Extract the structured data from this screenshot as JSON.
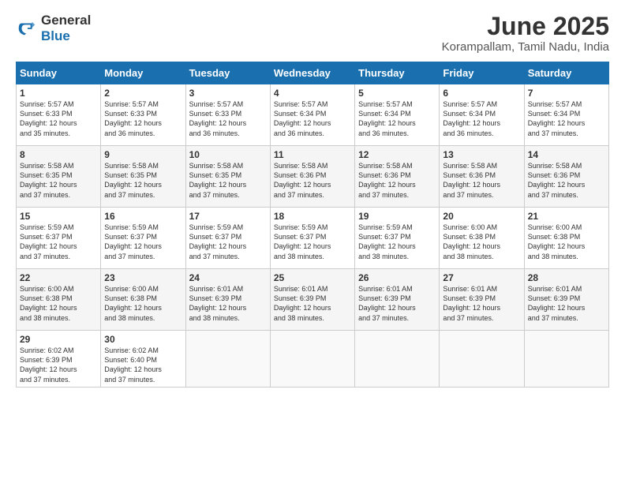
{
  "header": {
    "logo_general": "General",
    "logo_blue": "Blue",
    "title": "June 2025",
    "subtitle": "Korampallam, Tamil Nadu, India"
  },
  "weekdays": [
    "Sunday",
    "Monday",
    "Tuesday",
    "Wednesday",
    "Thursday",
    "Friday",
    "Saturday"
  ],
  "weeks": [
    [
      {
        "day": "1",
        "info": "Sunrise: 5:57 AM\nSunset: 6:33 PM\nDaylight: 12 hours\nand 35 minutes."
      },
      {
        "day": "2",
        "info": "Sunrise: 5:57 AM\nSunset: 6:33 PM\nDaylight: 12 hours\nand 36 minutes."
      },
      {
        "day": "3",
        "info": "Sunrise: 5:57 AM\nSunset: 6:33 PM\nDaylight: 12 hours\nand 36 minutes."
      },
      {
        "day": "4",
        "info": "Sunrise: 5:57 AM\nSunset: 6:34 PM\nDaylight: 12 hours\nand 36 minutes."
      },
      {
        "day": "5",
        "info": "Sunrise: 5:57 AM\nSunset: 6:34 PM\nDaylight: 12 hours\nand 36 minutes."
      },
      {
        "day": "6",
        "info": "Sunrise: 5:57 AM\nSunset: 6:34 PM\nDaylight: 12 hours\nand 36 minutes."
      },
      {
        "day": "7",
        "info": "Sunrise: 5:57 AM\nSunset: 6:34 PM\nDaylight: 12 hours\nand 37 minutes."
      }
    ],
    [
      {
        "day": "8",
        "info": "Sunrise: 5:58 AM\nSunset: 6:35 PM\nDaylight: 12 hours\nand 37 minutes."
      },
      {
        "day": "9",
        "info": "Sunrise: 5:58 AM\nSunset: 6:35 PM\nDaylight: 12 hours\nand 37 minutes."
      },
      {
        "day": "10",
        "info": "Sunrise: 5:58 AM\nSunset: 6:35 PM\nDaylight: 12 hours\nand 37 minutes."
      },
      {
        "day": "11",
        "info": "Sunrise: 5:58 AM\nSunset: 6:36 PM\nDaylight: 12 hours\nand 37 minutes."
      },
      {
        "day": "12",
        "info": "Sunrise: 5:58 AM\nSunset: 6:36 PM\nDaylight: 12 hours\nand 37 minutes."
      },
      {
        "day": "13",
        "info": "Sunrise: 5:58 AM\nSunset: 6:36 PM\nDaylight: 12 hours\nand 37 minutes."
      },
      {
        "day": "14",
        "info": "Sunrise: 5:58 AM\nSunset: 6:36 PM\nDaylight: 12 hours\nand 37 minutes."
      }
    ],
    [
      {
        "day": "15",
        "info": "Sunrise: 5:59 AM\nSunset: 6:37 PM\nDaylight: 12 hours\nand 37 minutes."
      },
      {
        "day": "16",
        "info": "Sunrise: 5:59 AM\nSunset: 6:37 PM\nDaylight: 12 hours\nand 37 minutes."
      },
      {
        "day": "17",
        "info": "Sunrise: 5:59 AM\nSunset: 6:37 PM\nDaylight: 12 hours\nand 37 minutes."
      },
      {
        "day": "18",
        "info": "Sunrise: 5:59 AM\nSunset: 6:37 PM\nDaylight: 12 hours\nand 38 minutes."
      },
      {
        "day": "19",
        "info": "Sunrise: 5:59 AM\nSunset: 6:37 PM\nDaylight: 12 hours\nand 38 minutes."
      },
      {
        "day": "20",
        "info": "Sunrise: 6:00 AM\nSunset: 6:38 PM\nDaylight: 12 hours\nand 38 minutes."
      },
      {
        "day": "21",
        "info": "Sunrise: 6:00 AM\nSunset: 6:38 PM\nDaylight: 12 hours\nand 38 minutes."
      }
    ],
    [
      {
        "day": "22",
        "info": "Sunrise: 6:00 AM\nSunset: 6:38 PM\nDaylight: 12 hours\nand 38 minutes."
      },
      {
        "day": "23",
        "info": "Sunrise: 6:00 AM\nSunset: 6:38 PM\nDaylight: 12 hours\nand 38 minutes."
      },
      {
        "day": "24",
        "info": "Sunrise: 6:01 AM\nSunset: 6:39 PM\nDaylight: 12 hours\nand 38 minutes."
      },
      {
        "day": "25",
        "info": "Sunrise: 6:01 AM\nSunset: 6:39 PM\nDaylight: 12 hours\nand 38 minutes."
      },
      {
        "day": "26",
        "info": "Sunrise: 6:01 AM\nSunset: 6:39 PM\nDaylight: 12 hours\nand 37 minutes."
      },
      {
        "day": "27",
        "info": "Sunrise: 6:01 AM\nSunset: 6:39 PM\nDaylight: 12 hours\nand 37 minutes."
      },
      {
        "day": "28",
        "info": "Sunrise: 6:01 AM\nSunset: 6:39 PM\nDaylight: 12 hours\nand 37 minutes."
      }
    ],
    [
      {
        "day": "29",
        "info": "Sunrise: 6:02 AM\nSunset: 6:39 PM\nDaylight: 12 hours\nand 37 minutes."
      },
      {
        "day": "30",
        "info": "Sunrise: 6:02 AM\nSunset: 6:40 PM\nDaylight: 12 hours\nand 37 minutes."
      },
      null,
      null,
      null,
      null,
      null
    ]
  ]
}
